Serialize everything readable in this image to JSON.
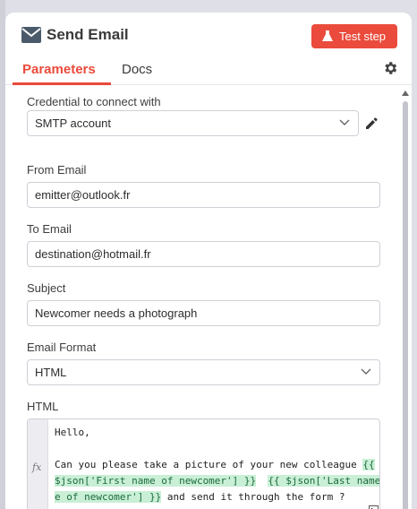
{
  "header": {
    "title": "Send Email",
    "icon": "envelope-icon",
    "test_step_label": "Test step",
    "test_step_icon": "flask-icon",
    "accent_color": "#ea4b3c"
  },
  "tabs": [
    {
      "label": "Parameters",
      "active": true
    },
    {
      "label": "Docs",
      "active": false
    }
  ],
  "fields": {
    "credential": {
      "label": "Credential to connect with",
      "value": "SMTP account"
    },
    "from_email": {
      "label": "From Email",
      "value": "emitter@outlook.fr"
    },
    "to_email": {
      "label": "To Email",
      "value": "destination@hotmail.fr"
    },
    "subject": {
      "label": "Subject",
      "value": "Newcomer needs a photograph"
    },
    "email_format": {
      "label": "Email Format",
      "value": "HTML"
    },
    "html": {
      "label": "HTML",
      "gutter_label": "fx",
      "line1": "Hello,",
      "line3_text": "Can you please take a picture of your new colleague ",
      "line3_expr": "{{",
      "line4_expr_a": "$json['First name of newcomer'] }}",
      "line4_gap": "  ",
      "line4_expr_b": "{{ $json['Last name",
      "line5_expr": "e of newcomer'] }}",
      "line5_text": " and send it through the form ?"
    }
  }
}
